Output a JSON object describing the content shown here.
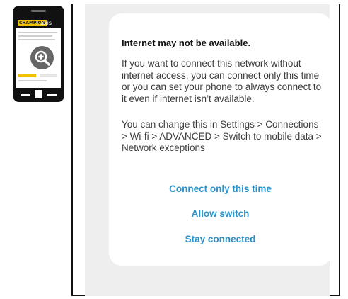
{
  "phone_icon": {
    "brand_left": "CHAMPION",
    "brand_right": "axis"
  },
  "dialog": {
    "title": "Internet may not be available.",
    "paragraphs": [
      "If you want to connect this network without internet access, you can connect only this time or you can set your phone to always connect to it even if internet isn’t available.",
      "You can change this in Settings > Connections > Wi-fi > ADVANCED > Switch to mobile data > Network exceptions"
    ],
    "actions": [
      "Connect only this time",
      "Allow switch",
      "Stay connected"
    ]
  },
  "colors": {
    "accent": "#2a92c9",
    "backdrop": "#eeeeee",
    "brand_yellow": "#f2c200"
  }
}
